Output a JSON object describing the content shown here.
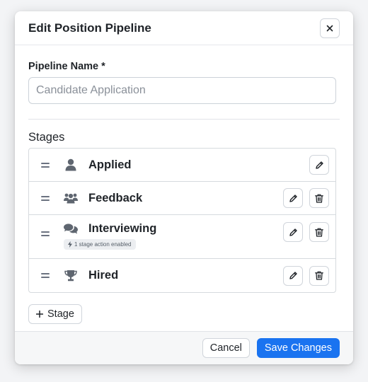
{
  "modal": {
    "title": "Edit Position Pipeline",
    "close_icon": "close-icon"
  },
  "pipeline_name": {
    "label": "Pipeline Name *",
    "value": "",
    "placeholder": "Candidate Application"
  },
  "stages": {
    "label": "Stages",
    "items": [
      {
        "name": "Applied",
        "icon": "user-icon",
        "deletable": false,
        "badge": ""
      },
      {
        "name": "Feedback",
        "icon": "users-icon",
        "deletable": true,
        "badge": ""
      },
      {
        "name": "Interviewing",
        "icon": "comments-icon",
        "deletable": true,
        "badge": "1 stage action enabled"
      },
      {
        "name": "Hired",
        "icon": "trophy-icon",
        "deletable": true,
        "badge": ""
      }
    ],
    "add_label": "Stage"
  },
  "footer": {
    "cancel_label": "Cancel",
    "save_label": "Save Changes"
  },
  "colors": {
    "primary": "#1a73f0",
    "icon": "#5f6670"
  }
}
